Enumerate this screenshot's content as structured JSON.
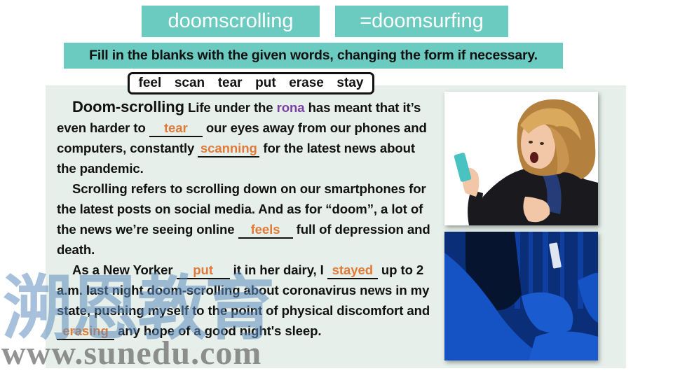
{
  "titles": {
    "left": "doomscrolling",
    "right": "=doomsurfing"
  },
  "instruction": "Fill in the blanks with the given words, changing the form if necessary.",
  "word_bank": "feel  scan  tear  put  erase  stay",
  "passage": {
    "p1": {
      "heading": "Doom-scrolling",
      "t1": " Life under the ",
      "rona": "rona",
      "t2": " has meant that it’s even harder to ",
      "blank1": "tear",
      "t3": " our eyes away from our phones and computers, constantly ",
      "blank2": "scanning",
      "t4": " for the latest news about the pandemic."
    },
    "p2": {
      "t1": "Scrolling refers to scrolling down on our smartphones for the latest posts on social media. And as for “doom”, a lot of the news we’re seeing online ",
      "blank3": "feels",
      "t2": " full of depression and death."
    },
    "p3": {
      "t1": "As a New Yorker ",
      "blank4": "put",
      "t2": " it in her dairy, I ",
      "blank5": "stayed",
      "t3": " up to 2 a.m. last night doom-scrolling about coronavirus news in my state, pushing myself to the point of physical discomfort and ",
      "blank6": "erasing",
      "t4": " any hope of a good night's sleep."
    }
  },
  "images": {
    "top": "woman-shocked-at-phone",
    "bottom": "person-in-bed-using-phone-at-night"
  },
  "watermark": {
    "chinese": "溯恩教育",
    "url": "www.sunedu.com"
  },
  "colors": {
    "accent_teal": "#6ccbc1",
    "answer_orange": "#e07b39",
    "rona_purple": "#7b3fa0",
    "panel_bg": "#e6efea"
  }
}
